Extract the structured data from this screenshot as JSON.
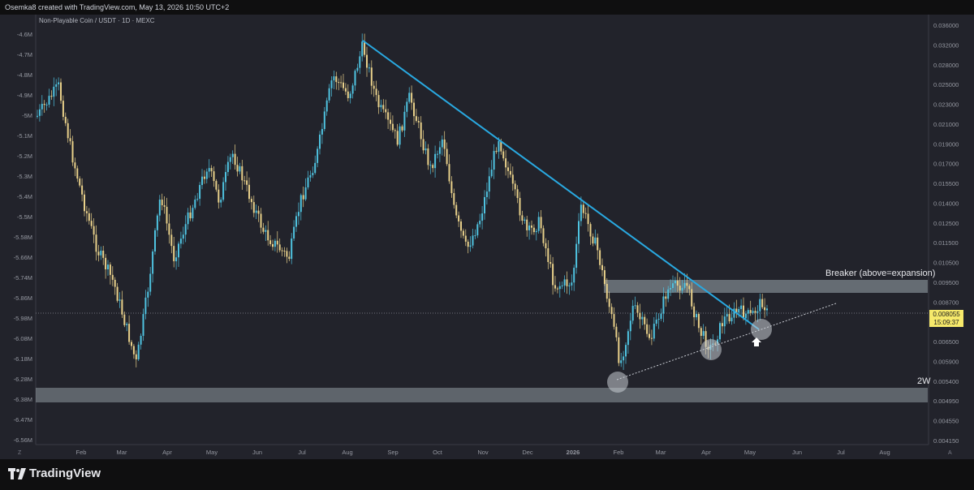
{
  "header": {
    "author_line": "Osemka8 created with TradingView.com, May 13, 2026 10:50 UTC+2"
  },
  "chart": {
    "symbol_line": "Non-Playable Coin / USDT · 1D · MEXC",
    "left_axis_ticks": [
      "-4.6M",
      "-4.7M",
      "-4.8M",
      "-4.9M",
      "-5M",
      "-5.1M",
      "-5.2M",
      "-5.3M",
      "-5.4M",
      "-5.5M",
      "-5.58M",
      "-5.66M",
      "-5.74M",
      "-5.86M",
      "-5.98M",
      "-6.08M",
      "-6.18M",
      "-6.28M",
      "-6.38M",
      "-6.47M",
      "-6.56M"
    ],
    "right_axis_ticks": [
      "0.036000",
      "0.032000",
      "0.028000",
      "0.025000",
      "0.023000",
      "0.021000",
      "0.019000",
      "0.017000",
      "0.015500",
      "0.014000",
      "0.012500",
      "0.011500",
      "0.010500",
      "0.009500",
      "0.008700",
      "0.007100",
      "0.006500",
      "0.005900",
      "0.005400",
      "0.004950",
      "0.004550",
      "0.004150"
    ],
    "x_axis_ticks": [
      "Feb",
      "Mar",
      "Apr",
      "May",
      "Jun",
      "Jul",
      "Aug",
      "Sep",
      "Oct",
      "Nov",
      "Dec",
      "2026",
      "Feb",
      "Mar",
      "Apr",
      "May",
      "Jun",
      "Jul",
      "Aug",
      "Sep"
    ],
    "x_axis_left_letter": "Z",
    "x_axis_right_letter": "A",
    "current_price": "0.008055",
    "countdown": "15:09:37",
    "annotations": {
      "breaker_label": "Breaker (above=expansion)",
      "zone_2w_label": "2W"
    },
    "colors": {
      "background": "#22232b",
      "up_candle": "#4fc3e0",
      "down_candle": "#e8d08a",
      "trendline": "#29a9e1",
      "zone": "#b9c6cc",
      "price_badge": "#f6e96b"
    },
    "icons": [
      "up-arrow-icon",
      "tradingview-logo-icon"
    ]
  },
  "footer": {
    "brand": "TradingView"
  }
}
